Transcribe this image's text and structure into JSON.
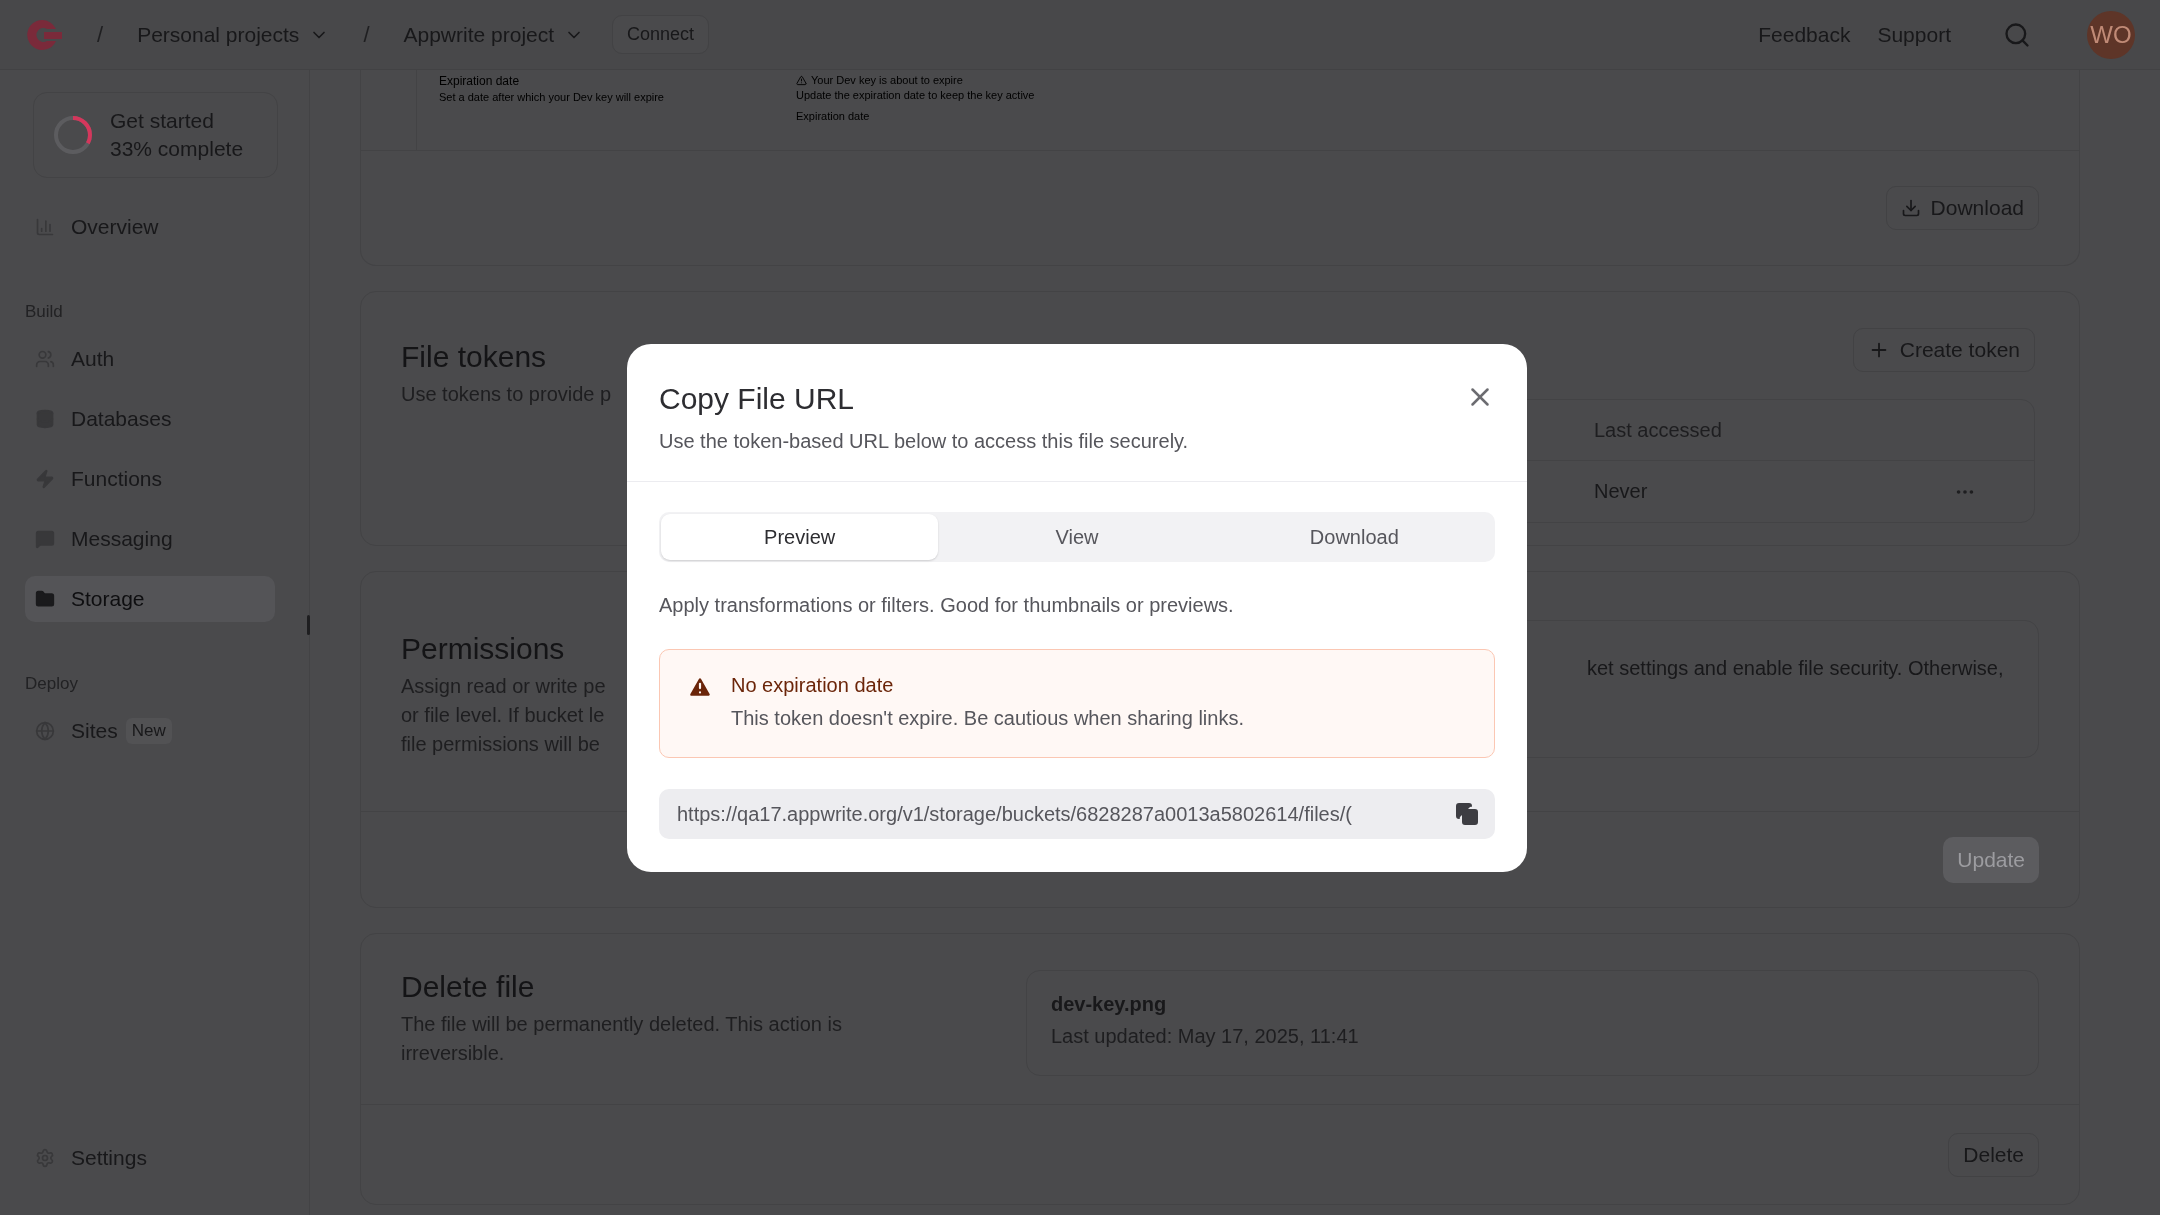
{
  "topbar": {
    "separator": "/",
    "breadcrumbs": [
      {
        "label": "Personal projects"
      },
      {
        "label": "Appwrite project"
      }
    ],
    "connect_button": "Connect",
    "links": [
      "Feedback",
      "Support"
    ],
    "avatar": "WO"
  },
  "sidebar": {
    "progress": {
      "title": "Get started",
      "subtitle": "33% complete",
      "level": 0.33
    },
    "sections": [
      {
        "items": [
          {
            "label": "Overview",
            "selected": false
          }
        ]
      },
      {
        "label": "Build",
        "items": [
          {
            "label": "Auth",
            "selected": false
          },
          {
            "label": "Databases",
            "selected": false
          },
          {
            "label": "Functions",
            "selected": false
          },
          {
            "label": "Messaging",
            "selected": false
          },
          {
            "label": "Storage",
            "selected": true
          }
        ]
      },
      {
        "label": "Deploy",
        "items": [
          {
            "label": "Sites",
            "badge": "New",
            "selected": false
          }
        ]
      }
    ],
    "footer_item": {
      "label": "Settings",
      "selected": false
    }
  },
  "preview_card": {
    "thumbnail": {
      "field_title": "Expiration date",
      "field_hint": "Set a date after which your Dev key will expire",
      "warning_title": "Your Dev key is about to expire",
      "warning_text": "Update the expiration date to keep the key active",
      "input_label": "Expiration date"
    },
    "download_button": "Download"
  },
  "file_tokens": {
    "title": "File tokens",
    "description": "Use tokens to provide p",
    "create_button": "Create token",
    "columns": [
      "Last accessed"
    ],
    "rows": [
      {
        "cells": [
          "Never"
        ]
      }
    ]
  },
  "permissions": {
    "title": "Permissions",
    "description_lines": [
      "Assign read or write pe",
      "or file level. If bucket le",
      "file permissions will be"
    ],
    "notice": "ket settings and enable file security. Otherwise,",
    "update_button": {
      "label": "Update",
      "disabled": true
    }
  },
  "delete_file": {
    "title": "Delete file",
    "description": "The file will be permanently deleted. This action is irreversible.",
    "file_name": "dev-key.png",
    "updated": "Last updated: May 17, 2025, 11:41",
    "delete_button": "Delete"
  },
  "modal": {
    "title": "Copy File URL",
    "subtitle": "Use the token-based URL below to access this file securely.",
    "tabs": [
      {
        "label": "Preview",
        "selected": true
      },
      {
        "label": "View",
        "selected": false
      },
      {
        "label": "Download",
        "selected": false
      }
    ],
    "tab_description": "Apply transformations or filters. Good for thumbnails or previews.",
    "alert": {
      "title": "No expiration date",
      "message": "This token doesn't expire. Be cautious when sharing links."
    },
    "url": "https://qa17.appwrite.org/v1/storage/buckets/6828287a0013a5802614/files/("
  }
}
